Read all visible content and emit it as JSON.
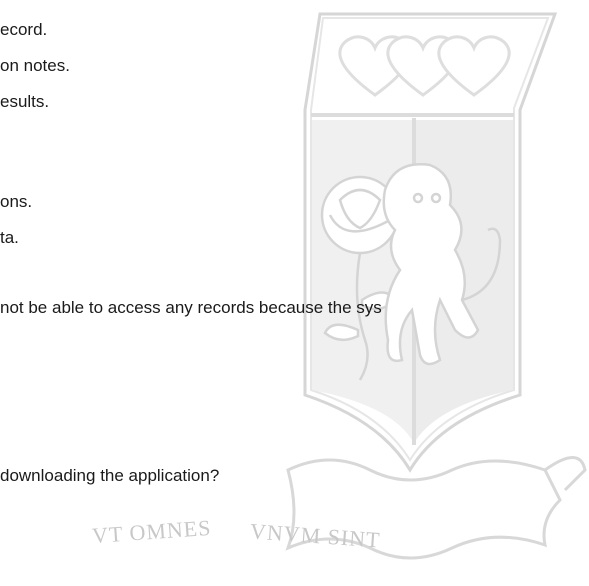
{
  "document": {
    "lines": [
      "ecord.",
      "on notes.",
      "esults.",
      "ons.",
      "ta.",
      "not be able to access any records because the sys",
      "downloading the application?"
    ]
  },
  "watermark": {
    "motto_left": "VT OMNES",
    "motto_right": "VNVM SINT",
    "color": "#c8c8c8"
  }
}
